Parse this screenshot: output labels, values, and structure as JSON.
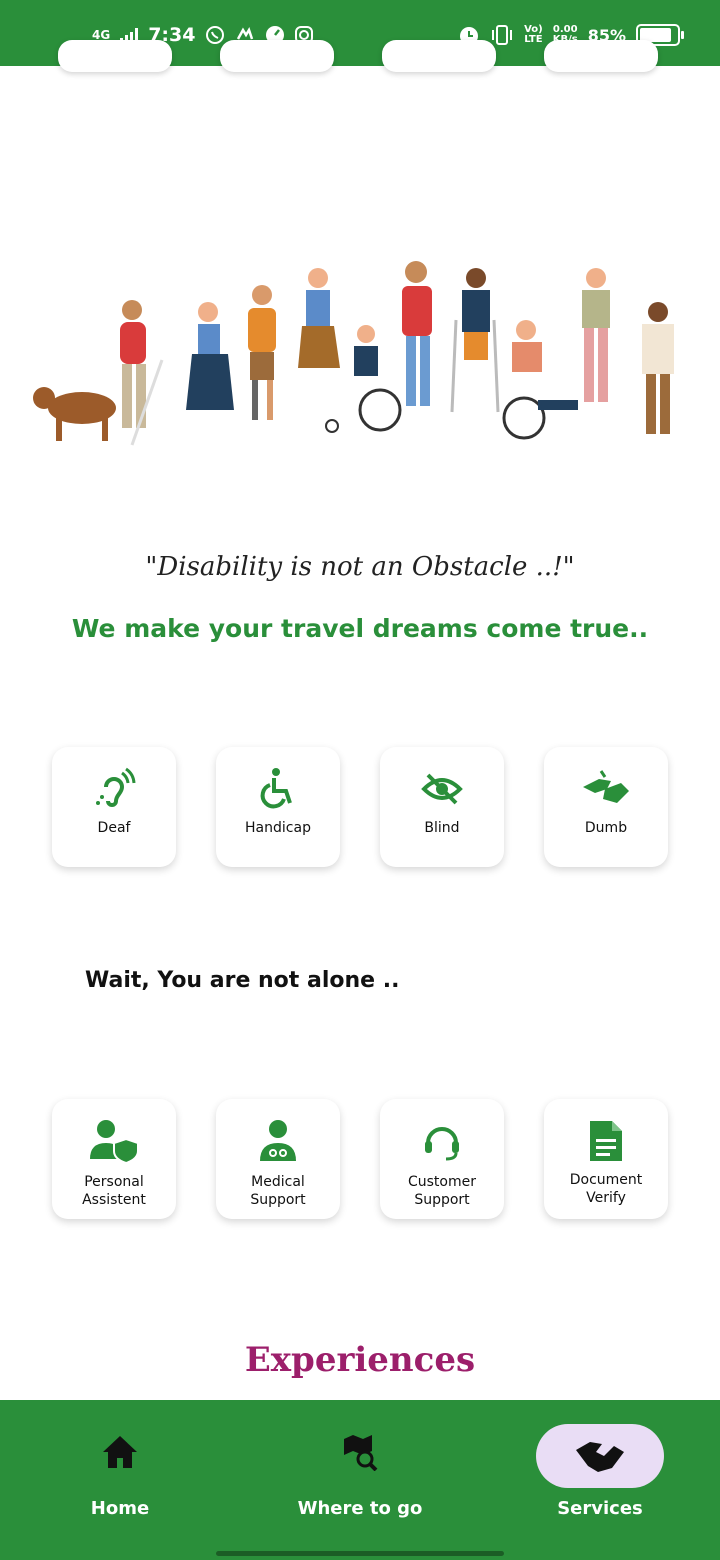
{
  "status_bar": {
    "network": "4G",
    "time": "7:34",
    "volte_top": "Vo)",
    "volte_bottom": "LTE",
    "speed_top": "0.00",
    "speed_bottom": "KB/s",
    "battery": "85%",
    "battery_level": 0.85
  },
  "hero": {
    "quote": "\"Disability is not an Obstacle ..!\"",
    "tagline": "We make your travel dreams come true.."
  },
  "disability_categories": [
    {
      "label": "Deaf",
      "icon": "hearing-icon"
    },
    {
      "label": "Handicap",
      "icon": "wheelchair-icon"
    },
    {
      "label": "Blind",
      "icon": "eye-off-icon"
    },
    {
      "label": "Dumb",
      "icon": "sign-language-icon"
    }
  ],
  "support_heading": "Wait, You are not alone ..",
  "support_services": [
    {
      "line1": "Personal",
      "line2": "Assistent",
      "icon": "person-shield-icon"
    },
    {
      "line1": "Medical",
      "line2": "Support",
      "icon": "doctor-icon"
    },
    {
      "line1": "Customer",
      "line2": "Support",
      "icon": "headset-icon"
    },
    {
      "line1": "Document",
      "line2": "Verify",
      "icon": "document-icon"
    }
  ],
  "experiences_heading": "Experiences",
  "bottom_nav": [
    {
      "label": "Home",
      "icon": "home-icon",
      "active": false
    },
    {
      "label": "Where to go",
      "icon": "map-search-icon",
      "active": false
    },
    {
      "label": "Services",
      "icon": "handshake-icon",
      "active": true
    }
  ],
  "colors": {
    "primary": "#2a8f3a",
    "accent": "#9c1f6b",
    "active_pill": "#e9ddf5"
  }
}
